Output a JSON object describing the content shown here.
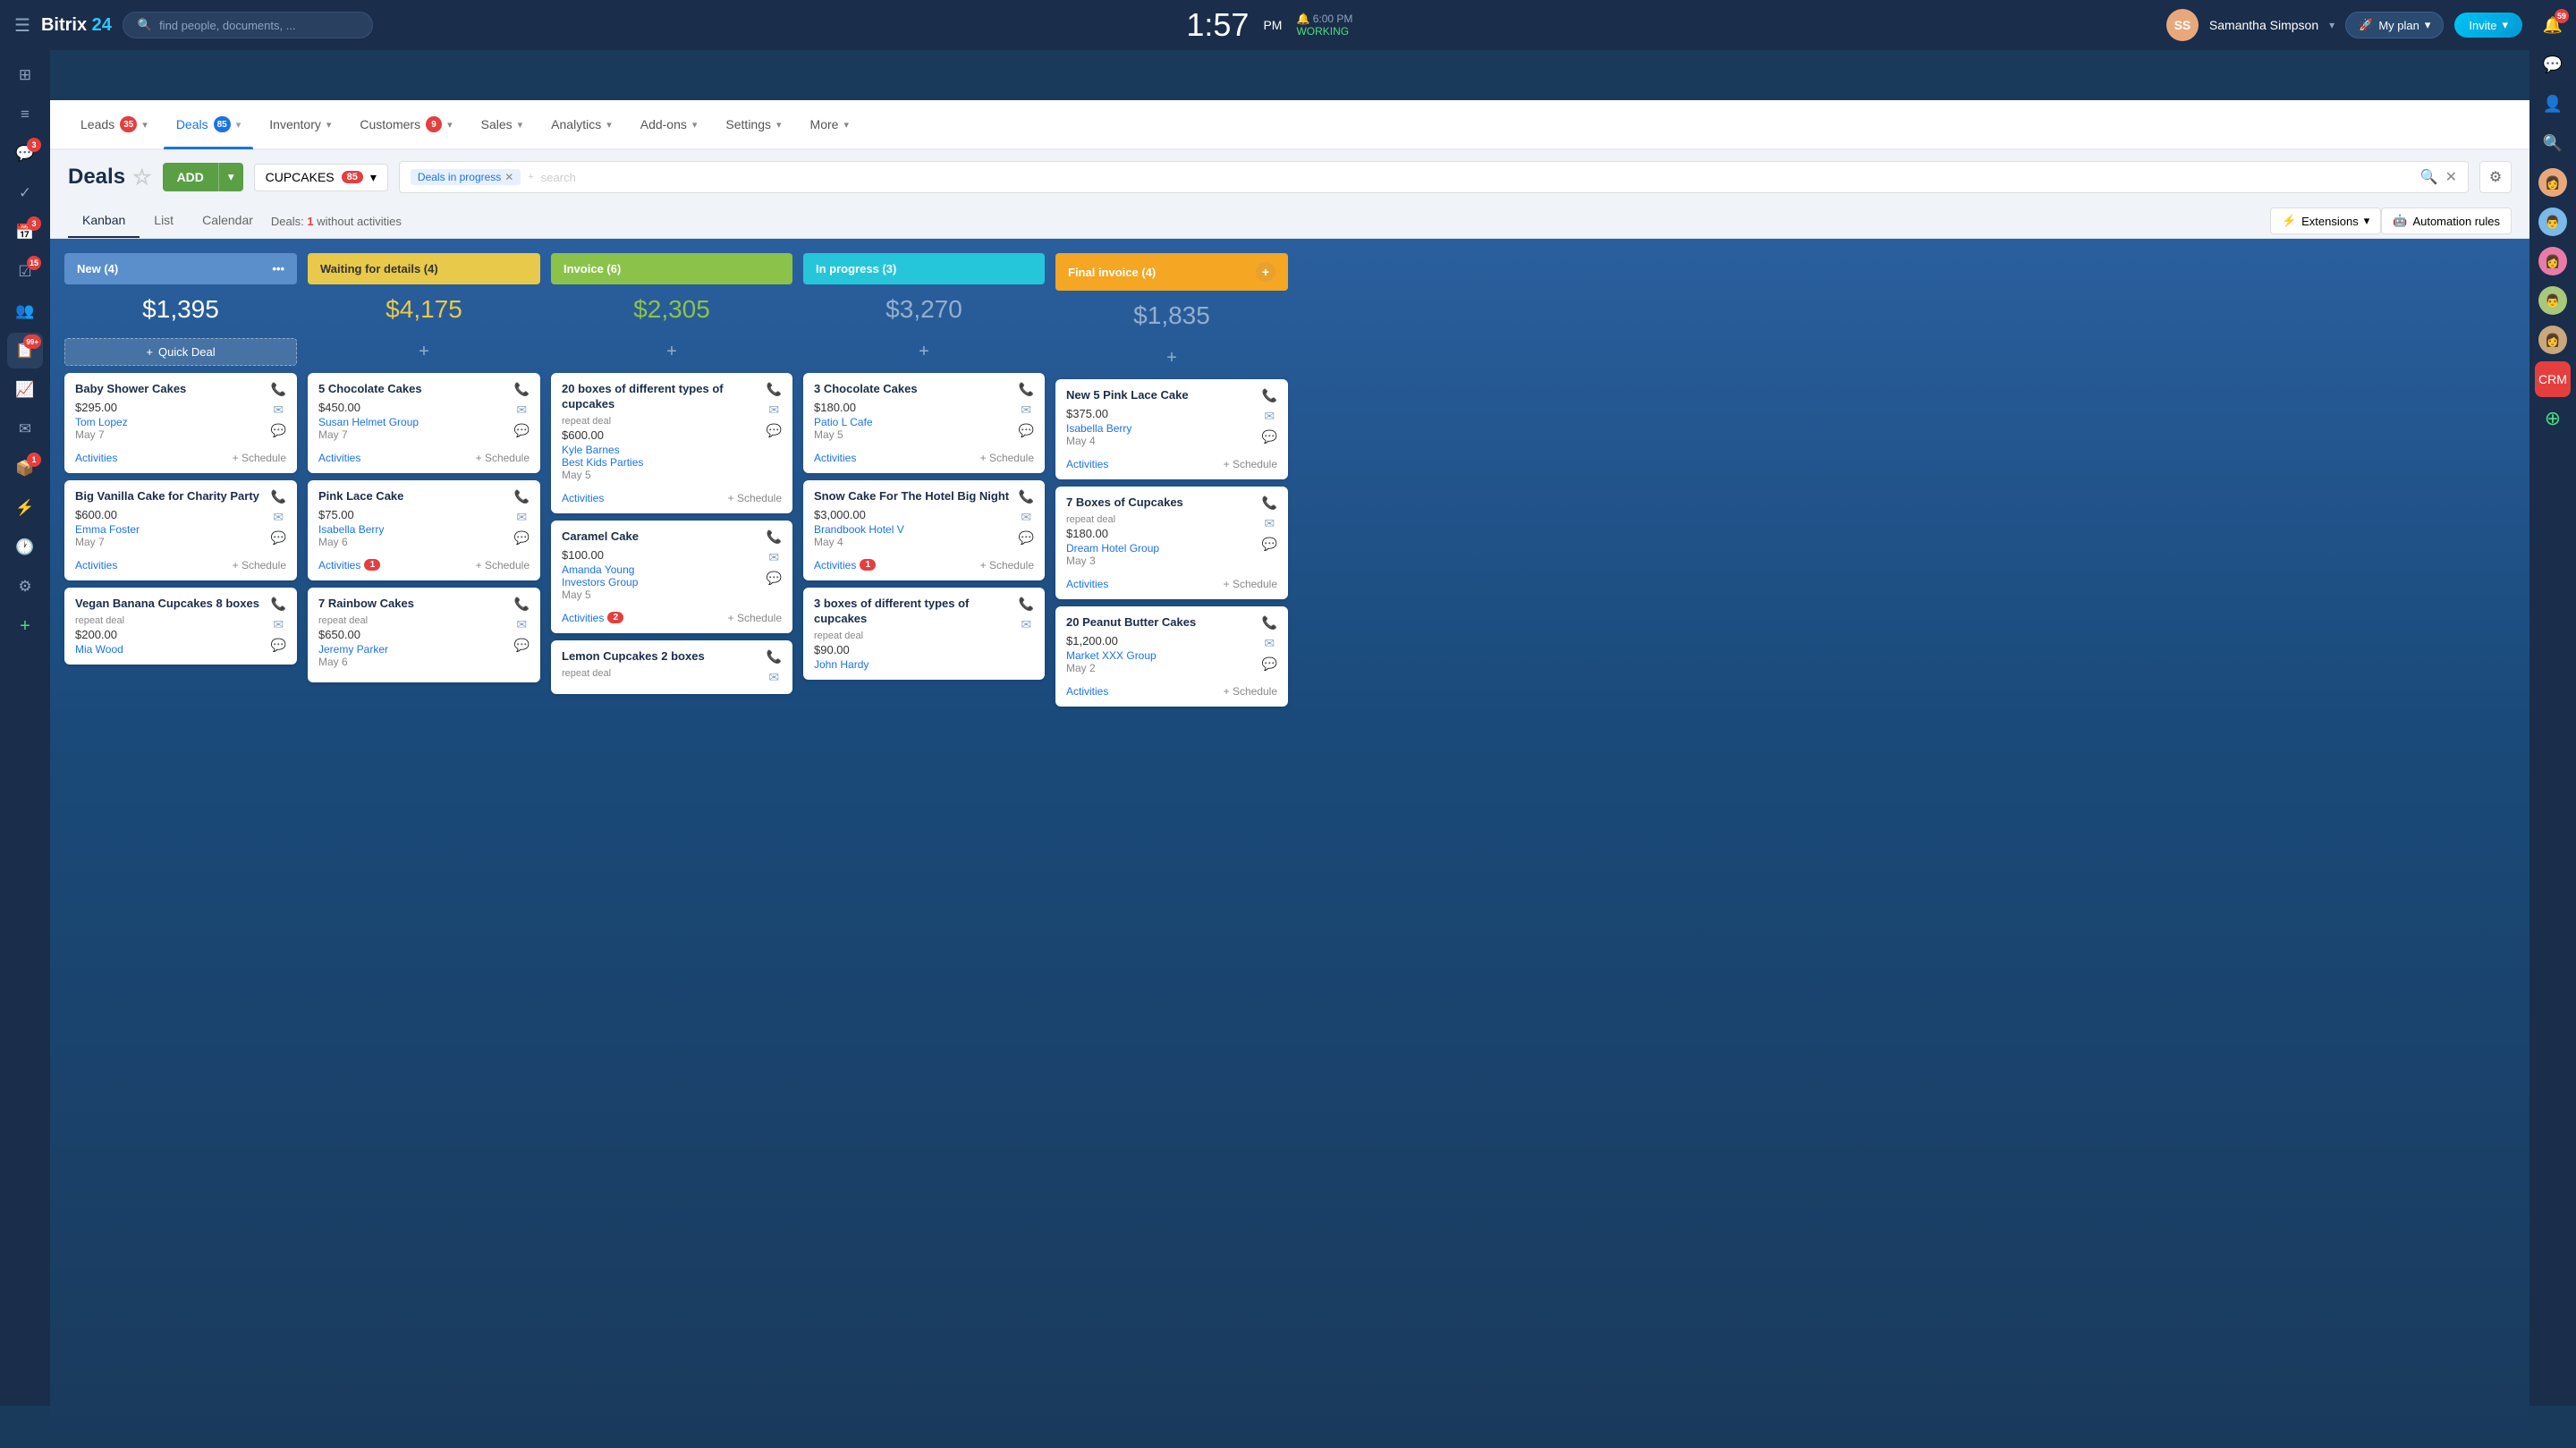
{
  "topnav": {
    "hamburger": "☰",
    "logo": "Bitrix",
    "logo_num": "24",
    "search_placeholder": "find people, documents, ...",
    "time": "1:57",
    "time_ampm": "PM",
    "clock_label": "6:00 PM",
    "status": "WORKING",
    "username": "Samantha Simpson",
    "plan_label": "My plan",
    "invite_label": "Invite",
    "help_label": "?"
  },
  "crm_nav": {
    "items": [
      {
        "label": "Leads",
        "badge": "35",
        "active": false
      },
      {
        "label": "Deals",
        "badge": "85",
        "active": true
      },
      {
        "label": "Inventory",
        "badge": "",
        "active": false
      },
      {
        "label": "Customers",
        "badge": "9",
        "active": false
      },
      {
        "label": "Sales",
        "badge": "",
        "active": false
      },
      {
        "label": "Analytics",
        "badge": "",
        "active": false
      },
      {
        "label": "Add-ons",
        "badge": "",
        "active": false
      },
      {
        "label": "Settings",
        "badge": "",
        "active": false
      },
      {
        "label": "More",
        "badge": "",
        "active": false
      }
    ]
  },
  "toolbar": {
    "title": "Deals",
    "star": "☆",
    "add_label": "ADD",
    "filter_label": "CUPCAKES",
    "filter_badge": "85",
    "search_filter_tag": "Deals in progress",
    "settings_icon": "⚙"
  },
  "view_tabs": {
    "tabs": [
      "Kanban",
      "List",
      "Calendar"
    ],
    "active": "Kanban",
    "deals_without": "Deals:",
    "deals_count": "1",
    "deals_suffix": "without activities",
    "extensions_label": "Extensions",
    "automation_label": "Automation rules"
  },
  "columns": [
    {
      "id": "new",
      "label": "New (4)",
      "type": "new",
      "total": "$1,395",
      "show_quick_deal": true,
      "cards": [
        {
          "title": "Baby Shower Cakes",
          "price": "$295.00",
          "tag": "",
          "contact": "Tom Lopez",
          "date": "May 7",
          "activities": "Activities",
          "schedule": "+ Schedule"
        },
        {
          "title": "Big Vanilla Cake for Charity Party",
          "price": "$600.00",
          "tag": "",
          "contact": "Emma Foster",
          "date": "May 7",
          "activities": "Activities",
          "schedule": "+ Schedule"
        },
        {
          "title": "Vegan Banana Cupcakes 8 boxes",
          "price": "$200.00",
          "tag": "repeat deal",
          "contact": "Mia Wood",
          "date": "",
          "activities": "Activities",
          "schedule": ""
        }
      ]
    },
    {
      "id": "waiting",
      "label": "Waiting for details (4)",
      "type": "waiting",
      "total": "$4,175",
      "show_quick_deal": false,
      "cards": [
        {
          "title": "5 Chocolate Cakes",
          "price": "$450.00",
          "tag": "",
          "contact": "Susan Helmet Group",
          "date": "May 7",
          "activities": "Activities",
          "schedule": "+ Schedule",
          "act_badge": ""
        },
        {
          "title": "Pink Lace Cake",
          "price": "$75.00",
          "tag": "",
          "contact": "Isabella Berry",
          "date": "May 6",
          "activities": "Activities",
          "schedule": "+ Schedule",
          "act_badge": "1"
        },
        {
          "title": "7 Rainbow Cakes",
          "price": "$650.00",
          "tag": "repeat deal",
          "contact": "Jeremy Parker",
          "date": "May 6",
          "activities": "Activities",
          "schedule": ""
        }
      ]
    },
    {
      "id": "invoice",
      "label": "Invoice (6)",
      "type": "invoice",
      "total": "$2,305",
      "show_quick_deal": false,
      "cards": [
        {
          "title": "20 boxes of different types of cupcakes",
          "price": "$600.00",
          "tag": "repeat deal",
          "contact": "Kyle Barnes",
          "contact2": "Best Kids Parties",
          "date": "May 5",
          "activities": "Activities",
          "schedule": "+ Schedule"
        },
        {
          "title": "Caramel Cake",
          "price": "$100.00",
          "tag": "",
          "contact": "Amanda Young",
          "contact2": "Investors Group",
          "date": "May 5",
          "activities": "Activities",
          "schedule": "",
          "act_badge": "2"
        },
        {
          "title": "Lemon Cupcakes 2 boxes",
          "price": "",
          "tag": "repeat deal",
          "contact": "",
          "date": "",
          "activities": "",
          "schedule": ""
        }
      ]
    },
    {
      "id": "in_progress",
      "label": "In progress (3)",
      "type": "in-progress",
      "total": "$3,270",
      "show_quick_deal": false,
      "cards": [
        {
          "title": "3 Chocolate Cakes",
          "price": "$180.00",
          "tag": "",
          "contact": "Patio L Cafe",
          "date": "May 5",
          "activities": "Activities",
          "schedule": "+ Schedule"
        },
        {
          "title": "Snow Cake For The Hotel Big Night",
          "price": "$3,000.00",
          "tag": "",
          "contact": "Brandbook Hotel V",
          "date": "May 4",
          "activities": "Activities",
          "schedule": "+ Schedule",
          "act_badge": "1"
        },
        {
          "title": "3 boxes of different types of cupcakes",
          "price": "$90.00",
          "tag": "repeat deal",
          "contact": "John Hardy",
          "date": "",
          "activities": "",
          "schedule": ""
        }
      ]
    },
    {
      "id": "final_invoice",
      "label": "Final invoice (4)",
      "type": "final-invoice",
      "total": "$1,835",
      "show_quick_deal": false,
      "cards": [
        {
          "title": "New 5 Pink Lace Cake",
          "price": "$375.00",
          "tag": "",
          "contact": "Isabella Berry",
          "date": "May 4",
          "activities": "Activities",
          "schedule": "+ Schedule"
        },
        {
          "title": "7 Boxes of Cupcakes",
          "price": "$180.00",
          "tag": "repeat deal",
          "contact": "Dream Hotel Group",
          "date": "May 3",
          "activities": "Activities",
          "schedule": "+ Schedule"
        },
        {
          "title": "20 Peanut Butter Cakes",
          "price": "$1,200.00",
          "tag": "",
          "contact": "Market XXX Group",
          "date": "May 2",
          "activities": "Activities",
          "schedule": "+ Schedule"
        }
      ]
    }
  ],
  "right_sidebar": {
    "icons": [
      {
        "name": "bell-icon",
        "symbol": "🔔",
        "badge": "59"
      },
      {
        "name": "chat-icon",
        "symbol": "💬",
        "badge": ""
      },
      {
        "name": "profile-icon",
        "symbol": "👤",
        "badge": ""
      },
      {
        "name": "search-icon",
        "symbol": "🔍",
        "badge": ""
      },
      {
        "name": "avatar1",
        "symbol": "👩",
        "badge": ""
      },
      {
        "name": "avatar2",
        "symbol": "👨",
        "badge": ""
      },
      {
        "name": "avatar3",
        "symbol": "👩",
        "badge": ""
      },
      {
        "name": "avatar4",
        "symbol": "👨",
        "badge": ""
      },
      {
        "name": "avatar5",
        "symbol": "👩",
        "badge": ""
      },
      {
        "name": "crm-icon",
        "symbol": "📊",
        "badge": ""
      }
    ]
  },
  "left_sidebar": {
    "icons": [
      {
        "name": "home-icon",
        "symbol": "⊞",
        "badge": ""
      },
      {
        "name": "feed-icon",
        "symbol": "≡",
        "badge": ""
      },
      {
        "name": "chat-ls-icon",
        "symbol": "💬",
        "badge": "3"
      },
      {
        "name": "tasks-icon",
        "symbol": "✓",
        "badge": ""
      },
      {
        "name": "calendar-icon",
        "symbol": "📅",
        "badge": "3"
      },
      {
        "name": "checklist-icon",
        "symbol": "☑",
        "badge": "15"
      },
      {
        "name": "contacts-icon",
        "symbol": "👥",
        "badge": ""
      },
      {
        "name": "crm-ls-icon",
        "symbol": "📋",
        "badge": "99+"
      },
      {
        "name": "chart-icon",
        "symbol": "📈",
        "badge": ""
      },
      {
        "name": "mail-icon",
        "symbol": "✉",
        "badge": ""
      },
      {
        "name": "box-icon",
        "symbol": "📦",
        "badge": "1"
      },
      {
        "name": "filter-icon",
        "symbol": "⚡",
        "badge": ""
      },
      {
        "name": "clock-icon",
        "symbol": "🕐",
        "badge": ""
      },
      {
        "name": "settings-icon",
        "symbol": "⚙",
        "badge": ""
      },
      {
        "name": "plus-icon",
        "symbol": "+",
        "badge": ""
      }
    ]
  }
}
